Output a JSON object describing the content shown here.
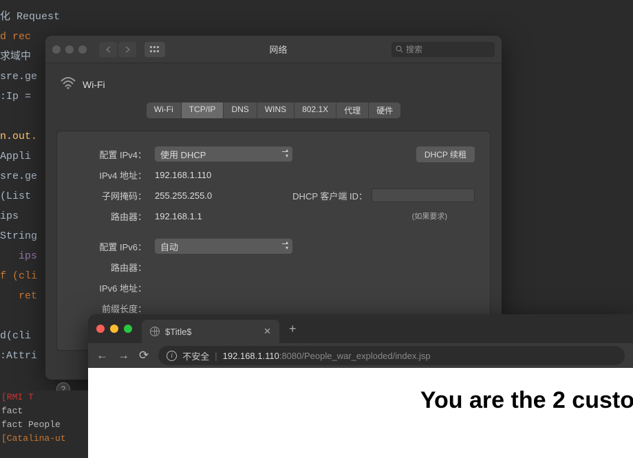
{
  "editor": {
    "lines": [
      {
        "cls": "id",
        "t": "化 Request"
      },
      {
        "cls": "kw",
        "t": "d rec"
      },
      {
        "cls": "id",
        "t": "求域中"
      },
      {
        "cls": "id",
        "t": "sre.ge"
      },
      {
        "cls": "id",
        "t": ":Ip ="
      },
      {
        "cls": "",
        "t": ""
      },
      {
        "cls": "fn",
        "t": "n.out."
      },
      {
        "cls": "id",
        "t": "Appli"
      },
      {
        "cls": "id",
        "t": "sre.ge"
      },
      {
        "cls": "id",
        "t": "(List"
      },
      {
        "cls": "id",
        "t": "ips"
      },
      {
        "cls": "id",
        "t": "String"
      },
      {
        "cls": "str",
        "t": "   ips"
      },
      {
        "cls": "kw",
        "t": "f (cli"
      },
      {
        "cls": "kw",
        "t": "   ret"
      },
      {
        "cls": "",
        "t": ""
      },
      {
        "cls": "id",
        "t": "d(cli"
      },
      {
        "cls": "id",
        "t": ":Attri"
      }
    ]
  },
  "prefs": {
    "title": "网络",
    "searchPlaceholder": "搜索",
    "connection": "Wi-Fi",
    "tabs": [
      "Wi-Fi",
      "TCP/IP",
      "DNS",
      "WINS",
      "802.1X",
      "代理",
      "硬件"
    ],
    "activeTab": 1,
    "ipv4": {
      "configLabel": "配置 IPv4：",
      "configValue": "使用 DHCP",
      "addrLabel": "IPv4 地址：",
      "addrValue": "192.168.1.110",
      "maskLabel": "子网掩码：",
      "maskValue": "255.255.255.0",
      "routerLabel": "路由器：",
      "routerValue": "192.168.1.1",
      "renewBtn": "DHCP 续租",
      "clientIdLabel": "DHCP 客户端 ID：",
      "clientIdHint": "(如果要求)"
    },
    "ipv6": {
      "configLabel": "配置 IPv6：",
      "configValue": "自动",
      "routerLabel": "路由器：",
      "addrLabel": "IPv6 地址：",
      "prefixLabel": "前缀长度："
    }
  },
  "browser": {
    "tabTitle": "$Title$",
    "insecure": "不安全",
    "urlHost": "192.168.1.110",
    "urlPort": ":8080",
    "urlPath": "/People_war_exploded/index.jsp",
    "pageText": "You are the 2 custo"
  },
  "console": {
    "lines": [
      {
        "cls": "r",
        "t": "[RMI T"
      },
      {
        "cls": "",
        "t": "fact"
      },
      {
        "cls": "",
        "t": "fact People"
      },
      {
        "cls": "o",
        "t": "[Catalina-ut"
      }
    ]
  }
}
